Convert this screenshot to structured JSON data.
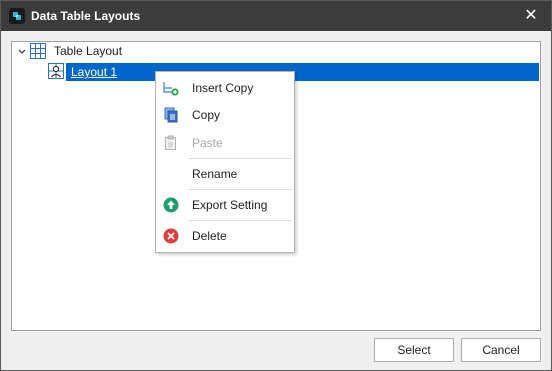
{
  "window": {
    "title": "Data Table Layouts",
    "close_glyph": "✕",
    "app_icon": "app-logo-icon"
  },
  "tree": {
    "root": {
      "label": "Table Layout",
      "icon": "table-grid-icon",
      "expanded": true
    },
    "children": [
      {
        "label": "Layout 1",
        "icon": "layout-item-icon",
        "selected": true
      }
    ]
  },
  "context_menu": {
    "items": [
      {
        "label": "Insert Copy",
        "icon": "insert-copy-icon",
        "enabled": true
      },
      {
        "label": "Copy",
        "icon": "copy-icon",
        "enabled": true
      },
      {
        "label": "Paste",
        "icon": "paste-icon",
        "enabled": false
      },
      {
        "label": "Rename",
        "icon": "",
        "enabled": true
      },
      {
        "label": "Export Setting",
        "icon": "export-icon",
        "enabled": true
      },
      {
        "label": "Delete",
        "icon": "delete-icon",
        "enabled": true
      }
    ]
  },
  "buttons": {
    "select": "Select",
    "cancel": "Cancel"
  },
  "colors": {
    "titlebar": "#3c3c3c",
    "selection": "#0066cc",
    "export_green": "#1e9e6e",
    "delete_red": "#e03c3c"
  }
}
